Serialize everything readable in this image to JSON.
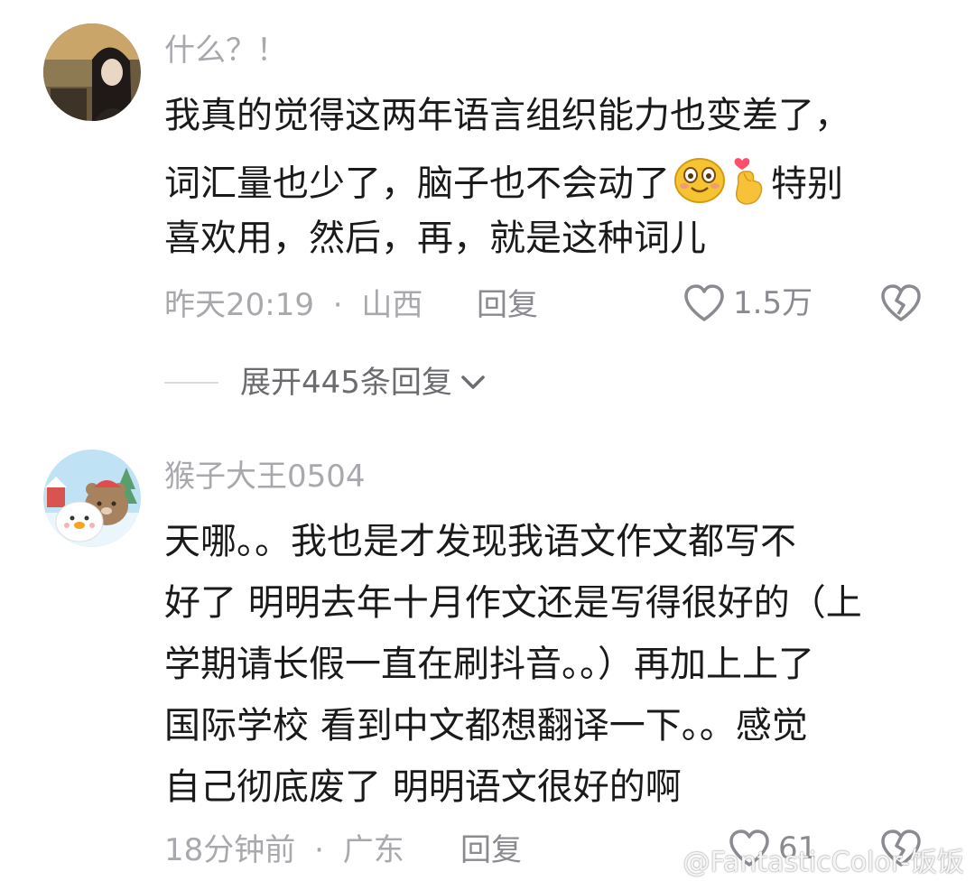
{
  "comments": [
    {
      "username": "什么？！",
      "lines": [
        "我真的觉得这两年语言组织能力也变差了，",
        "词汇量也少了，脑子也不会动了",
        "特别",
        "喜欢用，然后，再，就是这种词儿"
      ],
      "emojis": [
        "smile-emoji",
        "finger-heart-emoji"
      ],
      "time": "昨天20:19",
      "separator": "·",
      "location": "山西",
      "reply_label": "回复",
      "likes": "1.5万",
      "expand_label": "展开445条回复"
    },
    {
      "username": "猴子大王0504",
      "lines": [
        "天哪。。我也是才发现我语文作文都写不",
        "好了 明明去年十月作文还是写得很好的（上",
        "学期请长假一直在刷抖音。。）再加上上了",
        "国际学校 看到中文都想翻译一下。。感觉",
        "自己彻底废了 明明语文很好的啊"
      ],
      "time": "18分钟前",
      "separator": "·",
      "location": "广东",
      "reply_label": "回复",
      "likes": "61"
    }
  ],
  "watermark": "@FantasticColor-饭饭",
  "colors": {
    "text_primary": "#1a1a1a",
    "text_secondary": "#a8a8ad",
    "icon": "#8a8a90"
  }
}
